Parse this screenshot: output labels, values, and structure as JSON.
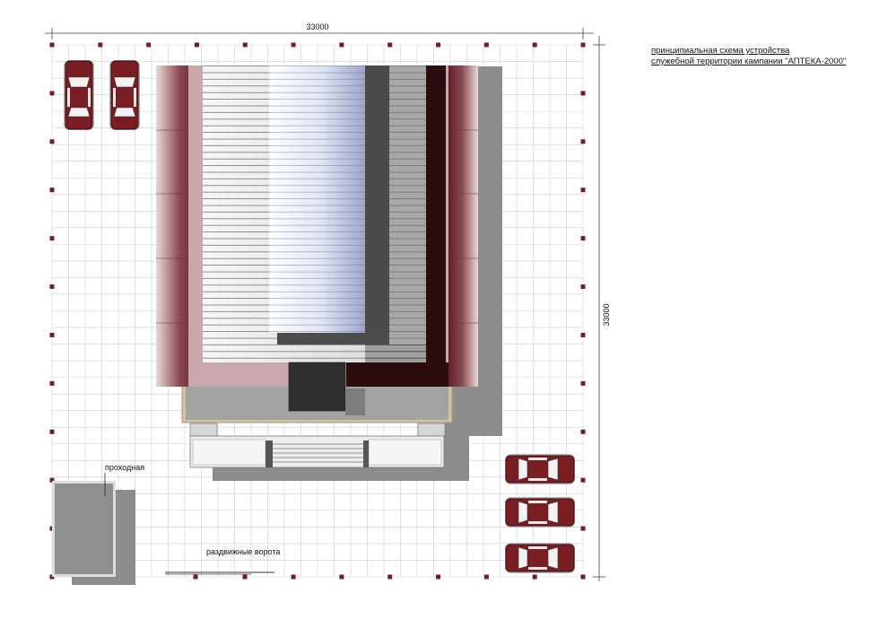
{
  "title": {
    "line1": "принципиальная схема устройства",
    "line2": "служебной территории кампании \"АПТЕКА-2000\""
  },
  "dimensions": {
    "top": "33000",
    "right": "33000"
  },
  "labels": {
    "checkpoint": "проходная",
    "gate": "раздвижные ворота"
  },
  "colors": {
    "grid": "#c9cbe6",
    "post": "#6b1f2b",
    "car_body": "#7a1e24",
    "roof_dark": "#2b0d0f",
    "roof_light": "#e9e9ec",
    "shadow": "#8c8c8c",
    "building_base": "#9a9a9a"
  }
}
